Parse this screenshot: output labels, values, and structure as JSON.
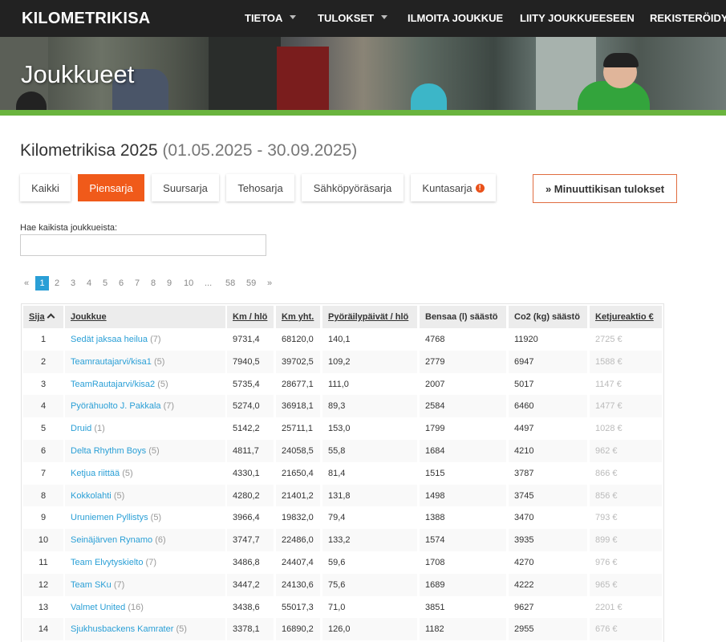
{
  "brand": "KILOMETRIKISA",
  "nav": {
    "tietoa": "TIETOA",
    "tulokset": "TULOKSET",
    "ilmoita": "ILMOITA JOUKKUE",
    "liity": "LIITY JOUKKUEESEEN",
    "rekisteroidy": "REKISTERÖIDY"
  },
  "banner": {
    "title": "Joukkueet"
  },
  "heading": {
    "title": "Kilometrikisa 2025",
    "dates": "(01.05.2025 - 30.09.2025)"
  },
  "tabs": [
    "Kaikki",
    "Piensarja",
    "Suursarja",
    "Tehosarja",
    "Sähköpyöräsarja",
    "Kuntasarja"
  ],
  "active_tab": "Piensarja",
  "minute_button": "» Minuuttikisan tulokset",
  "search": {
    "label": "Hae kaikista joukkueista:",
    "value": ""
  },
  "pagination": {
    "prev": "«",
    "pages": [
      "1",
      "2",
      "3",
      "4",
      "5",
      "6",
      "7",
      "8",
      "9",
      "10"
    ],
    "ellipsis": "...",
    "tail": [
      "58",
      "59"
    ],
    "next": "»",
    "current": "1"
  },
  "table": {
    "columns": [
      "Sija",
      "Joukkue",
      "Km / hlö",
      "Km yht.",
      "Pyöräilypäivät / hlö",
      "Bensaa (l) säästö",
      "Co2 (kg) säästö",
      "Ketjureaktio €"
    ],
    "rows": [
      {
        "rank": "1",
        "team": "Sedät jaksaa heilua",
        "members": "(7)",
        "km_person": "9731,4",
        "km_total": "68120,0",
        "days": "140,1",
        "fuel": "4768",
        "co2": "11920",
        "chain": "2725 €"
      },
      {
        "rank": "2",
        "team": "Teamrautajarvi/kisa1",
        "members": "(5)",
        "km_person": "7940,5",
        "km_total": "39702,5",
        "days": "109,2",
        "fuel": "2779",
        "co2": "6947",
        "chain": "1588 €"
      },
      {
        "rank": "3",
        "team": "TeamRautajarvi/kisa2",
        "members": "(5)",
        "km_person": "5735,4",
        "km_total": "28677,1",
        "days": "111,0",
        "fuel": "2007",
        "co2": "5017",
        "chain": "1147 €"
      },
      {
        "rank": "4",
        "team": "Pyörähuolto J. Pakkala",
        "members": "(7)",
        "km_person": "5274,0",
        "km_total": "36918,1",
        "days": "89,3",
        "fuel": "2584",
        "co2": "6460",
        "chain": "1477 €"
      },
      {
        "rank": "5",
        "team": "Druid",
        "members": "(1)",
        "km_person": "5142,2",
        "km_total": "25711,1",
        "days": "153,0",
        "fuel": "1799",
        "co2": "4497",
        "chain": "1028 €"
      },
      {
        "rank": "6",
        "team": "Delta Rhythm Boys",
        "members": "(5)",
        "km_person": "4811,7",
        "km_total": "24058,5",
        "days": "55,8",
        "fuel": "1684",
        "co2": "4210",
        "chain": "962 €"
      },
      {
        "rank": "7",
        "team": "Ketjua riittää",
        "members": "(5)",
        "km_person": "4330,1",
        "km_total": "21650,4",
        "days": "81,4",
        "fuel": "1515",
        "co2": "3787",
        "chain": "866 €"
      },
      {
        "rank": "8",
        "team": "Kokkolahti",
        "members": "(5)",
        "km_person": "4280,2",
        "km_total": "21401,2",
        "days": "131,8",
        "fuel": "1498",
        "co2": "3745",
        "chain": "856 €"
      },
      {
        "rank": "9",
        "team": "Uruniemen Pyllistys",
        "members": "(5)",
        "km_person": "3966,4",
        "km_total": "19832,0",
        "days": "79,4",
        "fuel": "1388",
        "co2": "3470",
        "chain": "793 €"
      },
      {
        "rank": "10",
        "team": "Seinäjärven Rynamo",
        "members": "(6)",
        "km_person": "3747,7",
        "km_total": "22486,0",
        "days": "133,2",
        "fuel": "1574",
        "co2": "3935",
        "chain": "899 €"
      },
      {
        "rank": "11",
        "team": "Team Elvytyskielto",
        "members": "(7)",
        "km_person": "3486,8",
        "km_total": "24407,4",
        "days": "59,6",
        "fuel": "1708",
        "co2": "4270",
        "chain": "976 €"
      },
      {
        "rank": "12",
        "team": "Team SKu",
        "members": "(7)",
        "km_person": "3447,2",
        "km_total": "24130,6",
        "days": "75,6",
        "fuel": "1689",
        "co2": "4222",
        "chain": "965 €"
      },
      {
        "rank": "13",
        "team": "Valmet United",
        "members": "(16)",
        "km_person": "3438,6",
        "km_total": "55017,3",
        "days": "71,0",
        "fuel": "3851",
        "co2": "9627",
        "chain": "2201 €"
      },
      {
        "rank": "14",
        "team": "Sjukhusbackens Kamrater",
        "members": "(5)",
        "km_person": "3378,1",
        "km_total": "16890,2",
        "days": "126,0",
        "fuel": "1182",
        "co2": "2955",
        "chain": "676 €"
      }
    ]
  },
  "colors": {
    "navbar": "#222222",
    "accent_orange": "#f05a1a",
    "green_bar": "#6ab43e",
    "link": "#2a9fd6"
  }
}
